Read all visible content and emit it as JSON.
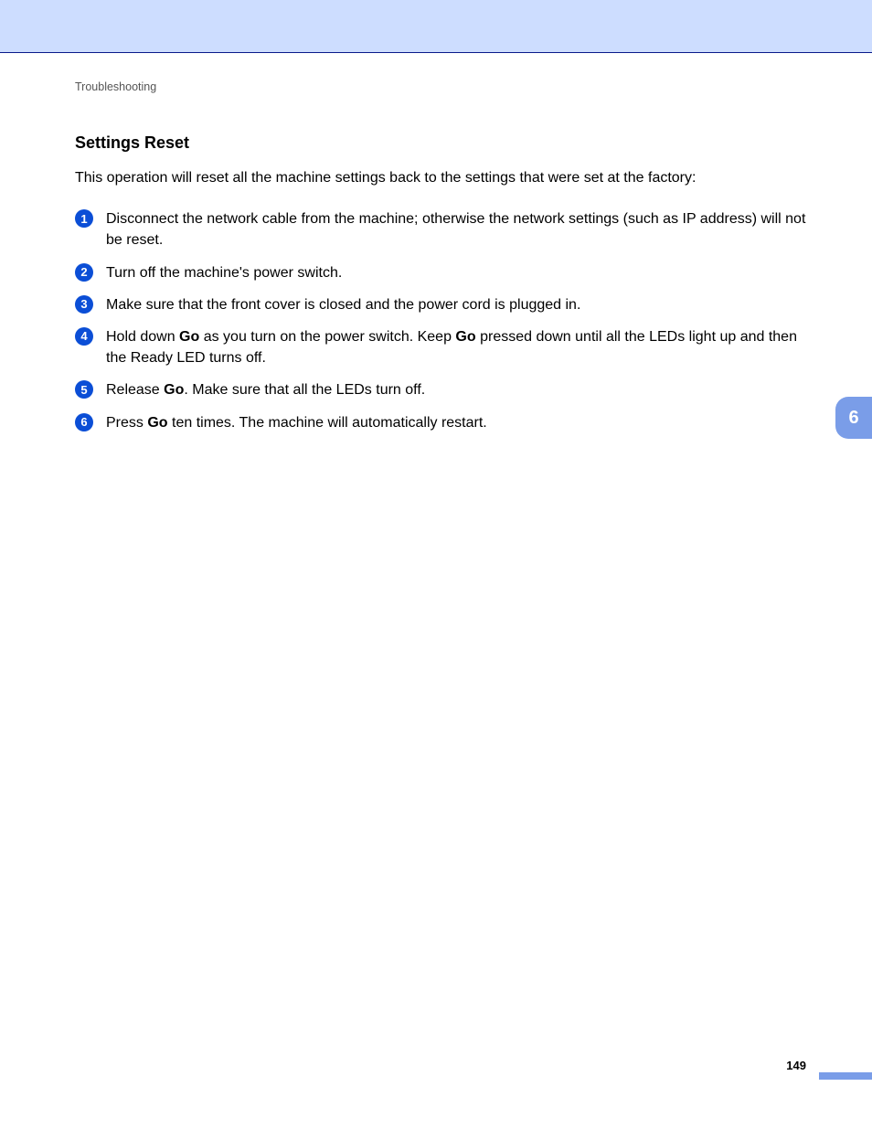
{
  "breadcrumb": "Troubleshooting",
  "section_title": "Settings Reset",
  "intro": "This operation will reset all the machine settings back to the settings that were set at the factory:",
  "steps": [
    {
      "n": "1",
      "parts": [
        {
          "t": "Disconnect the network cable from the machine; otherwise the network settings (such as IP address) will not be reset."
        }
      ]
    },
    {
      "n": "2",
      "parts": [
        {
          "t": "Turn off the machine's power switch."
        }
      ]
    },
    {
      "n": "3",
      "parts": [
        {
          "t": "Make sure that the front cover is closed and the power cord is plugged in."
        }
      ]
    },
    {
      "n": "4",
      "parts": [
        {
          "t": "Hold down "
        },
        {
          "t": "Go",
          "b": true
        },
        {
          "t": " as you turn on the power switch. Keep "
        },
        {
          "t": "Go",
          "b": true
        },
        {
          "t": " pressed down until all the LEDs light up and then the Ready LED turns off."
        }
      ]
    },
    {
      "n": "5",
      "parts": [
        {
          "t": "Release "
        },
        {
          "t": "Go",
          "b": true
        },
        {
          "t": ". Make sure that all the LEDs turn off."
        }
      ]
    },
    {
      "n": "6",
      "parts": [
        {
          "t": "Press "
        },
        {
          "t": "Go",
          "b": true
        },
        {
          "t": " ten times. The machine will automatically restart."
        }
      ]
    }
  ],
  "chapter_tab": "6",
  "page_number": "149"
}
